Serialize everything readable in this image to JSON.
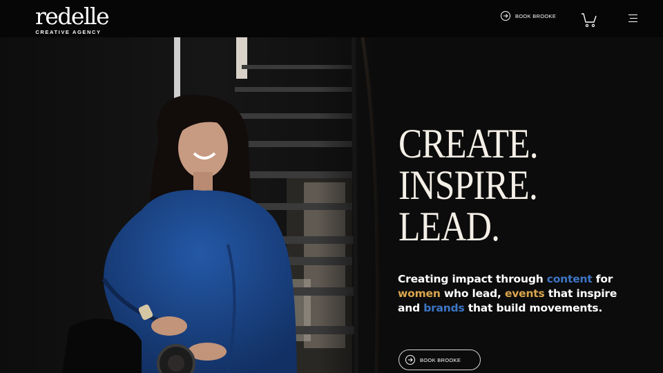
{
  "header": {
    "logo_word": "redelle",
    "logo_tag": "CREATIVE AGENCY",
    "book_label": "BOOK BROOKE",
    "icons": [
      "arrow-circle-icon",
      "cart-icon",
      "hamburger-menu-icon"
    ]
  },
  "hero": {
    "headline": [
      "CREATE.",
      "INSPIRE.",
      "LEAD."
    ],
    "tagline": {
      "p1": "Creating impact through ",
      "w1": "content",
      "p2": " for ",
      "w2": "women",
      "p3": " who lead, ",
      "w3": "events",
      "p4": " that inspire and ",
      "w4": "brands",
      "p5": " that build movements."
    },
    "cta_label": "BOOK BROOKE"
  },
  "colors": {
    "background": "#0b0b0b",
    "headline": "#f4efe7",
    "accent_blue": "#3d76c6",
    "accent_gold": "#d9a54d"
  }
}
